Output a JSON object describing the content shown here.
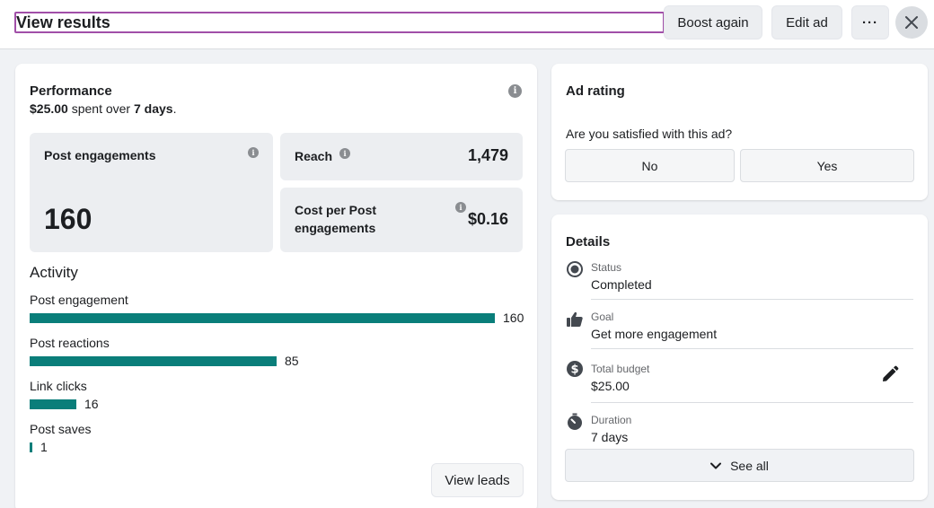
{
  "header": {
    "title": "View results",
    "boost_again": "Boost again",
    "edit_ad": "Edit ad",
    "more": "···"
  },
  "performance": {
    "title": "Performance",
    "spent_amount": "$25.00",
    "spent_text": " spent over ",
    "spent_days": "7 days",
    "spent_end": ".",
    "post_engagements_label": "Post engagements",
    "post_engagements_value": "160",
    "reach_label": "Reach",
    "reach_value": "1,479",
    "cost_label_line1": "Cost per Post",
    "cost_label_line2": "engagements",
    "cost_value": "$0.16"
  },
  "activity": {
    "title": "Activity",
    "max": 160,
    "items": [
      {
        "label": "Post engagement",
        "value": 160,
        "display": "160"
      },
      {
        "label": "Post reactions",
        "value": 85,
        "display": "85"
      },
      {
        "label": "Link clicks",
        "value": 16,
        "display": "16"
      },
      {
        "label": "Post saves",
        "value": 1,
        "display": "1"
      }
    ],
    "view_leads": "View leads"
  },
  "rating": {
    "title": "Ad rating",
    "question": "Are you satisfied with this ad?",
    "no": "No",
    "yes": "Yes"
  },
  "details": {
    "title": "Details",
    "rows": [
      {
        "icon": "status-icon",
        "label": "Status",
        "value": "Completed"
      },
      {
        "icon": "thumbs-up-icon",
        "label": "Goal",
        "value": "Get more engagement"
      },
      {
        "icon": "dollar-icon",
        "label": "Total budget",
        "value": "$25.00"
      },
      {
        "icon": "stopwatch-icon",
        "label": "Duration",
        "value": "7 days"
      }
    ],
    "see_all": "See all"
  },
  "colors": {
    "bar": "#0a7e7a",
    "title_outline": "#a14fa8"
  }
}
